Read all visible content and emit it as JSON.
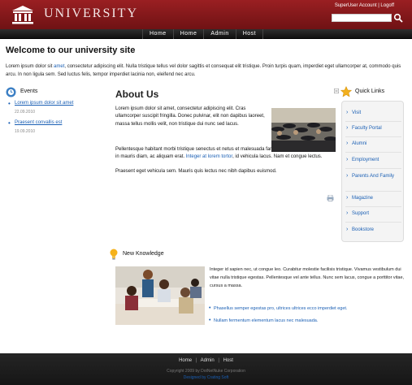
{
  "header": {
    "brand": "UNIVERSITY",
    "user_links": [
      "SuperUser Account",
      "Logoff"
    ],
    "user_sep": "|",
    "search": {
      "value": "",
      "placeholder": ""
    }
  },
  "nav": {
    "items": [
      "Home",
      "Home",
      "Admin",
      "Host"
    ]
  },
  "main": {
    "page_title": "Welcome to our university site",
    "intro": {
      "before": "Lorem ipsum dolor sit ",
      "link": "amet",
      "after": ", consectetur adipiscing elit. Nulla tristique tellus vel dolor sagittis et consequat elit tristique. Proin turpis quam, imperdiet eget ullamcorper at, commodo quis arcu. In non ligula sem. Sed luctus felis, tempor imperdiet lacinia non, eleifend nec arcu."
    }
  },
  "events": {
    "title": "Events",
    "items": [
      {
        "title": "Lorem ipsum dolor sit amet",
        "date": "22.09.2010"
      },
      {
        "title": "Praesent convallis est",
        "date": "19.09.2010"
      }
    ]
  },
  "about": {
    "title": "About Us",
    "p1": "Lorem ipsum dolor sit amet, consectetur adipiscing elit. Cras ullamcorper suscipit fringilla. Donec pulvinar, elit non dapibus laoreet, massa tellus mollis velit, non tristique dui nunc sed lacus.",
    "p2_before": "Pellentesque habitant morbi tristique senectus et netus et malesuada fames ac turpis egestas. Etiam in mauris diam, ac aliquam erat. ",
    "p2_link": "Integer at lorem tortor",
    "p2_after": ", id vehicula lacus. Nam et congue lectus.",
    "p3": "Praesent eget vehicula sem. Mauris quis lectus nec nibh dapibus euismod."
  },
  "quick_links": {
    "title": "Quick Links",
    "items": [
      "Visit",
      "Faculty Portal",
      "Alumni",
      "Employment",
      "Parents And Family",
      "Magazine",
      "Support",
      "Bookstore"
    ]
  },
  "new_knowledge": {
    "title": "New Knowledge",
    "text": "Integer id sapien nec, ut congue leo. Curabitur molestie facilisis tristique. Vivamus vestibulum dui vitae nulla tristique egestas. Pellentesque vel ante tellus. Nunc sem lacus, congue a porttitor vitae, cursus a massa.",
    "bullets": [
      "Phasellus semper egestas pro, ultrices ultrices ecco imperdiet eget.",
      "Nullam fermentum elementum lacus nec malesuada."
    ]
  },
  "footer": {
    "links": [
      "Home",
      "Admin",
      "Host"
    ],
    "sep": "|",
    "copyright": "Copyright 2009 by DotNetNuke Corporation",
    "designed_by": "Designed by Crating Soft"
  },
  "colors": {
    "header": "#8b1a1d",
    "link": "#1a5fb4",
    "nav": "#1c1c1c",
    "footer": "#1f1f1f"
  }
}
